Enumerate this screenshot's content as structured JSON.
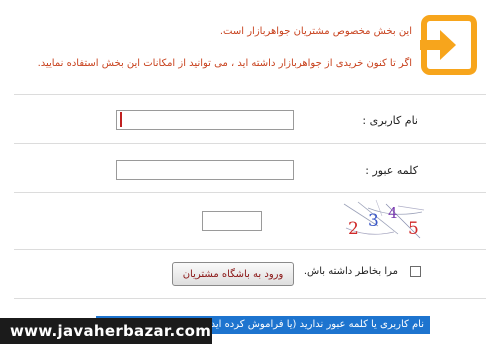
{
  "header": {
    "icon": "login-arrow-icon",
    "accent_color": "#f7a51c",
    "notice_line1": "این بخش مخصوص مشتریان جواهربازار است.",
    "notice_line2": "اگر تا کنون خریدی از جواهربازار داشته اید ، می توانید از امکانات این بخش استفاده نمایید."
  },
  "form": {
    "username_label": "نام کاربری :",
    "username_value": "",
    "password_label": "کلمه عبور :",
    "password_value": "",
    "captcha_value": "",
    "captcha_digits": [
      "2",
      "3",
      "4",
      "5"
    ],
    "remember_label": "مرا بخاطر داشته باش.",
    "remember_checked": false,
    "submit_label": "ورود به باشگاه مشتریان"
  },
  "footer": {
    "forgot_text": "نام کاربری یا کلمه عبور ندارید (یا فراموش کرده اید) ؟ کلیک کنید",
    "watermark": "www.javaherbazar.com"
  }
}
